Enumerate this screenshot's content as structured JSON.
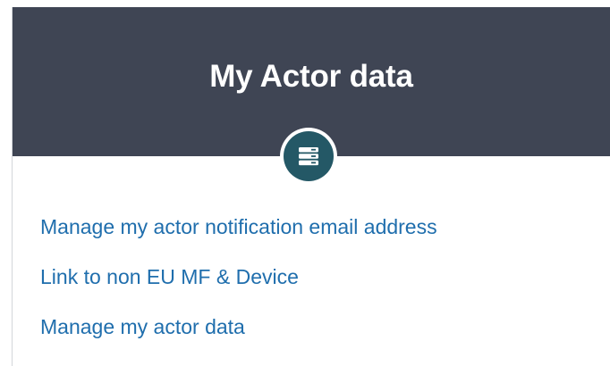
{
  "card": {
    "title": "My Actor data",
    "icon": "server-stack-icon",
    "colors": {
      "header_bg": "#3f4554",
      "icon_circle": "#245866",
      "link": "#1f6ead"
    }
  },
  "links": [
    {
      "label": "Manage my actor notification email address"
    },
    {
      "label": "Link to non EU MF & Device"
    },
    {
      "label": "Manage my actor data"
    }
  ]
}
